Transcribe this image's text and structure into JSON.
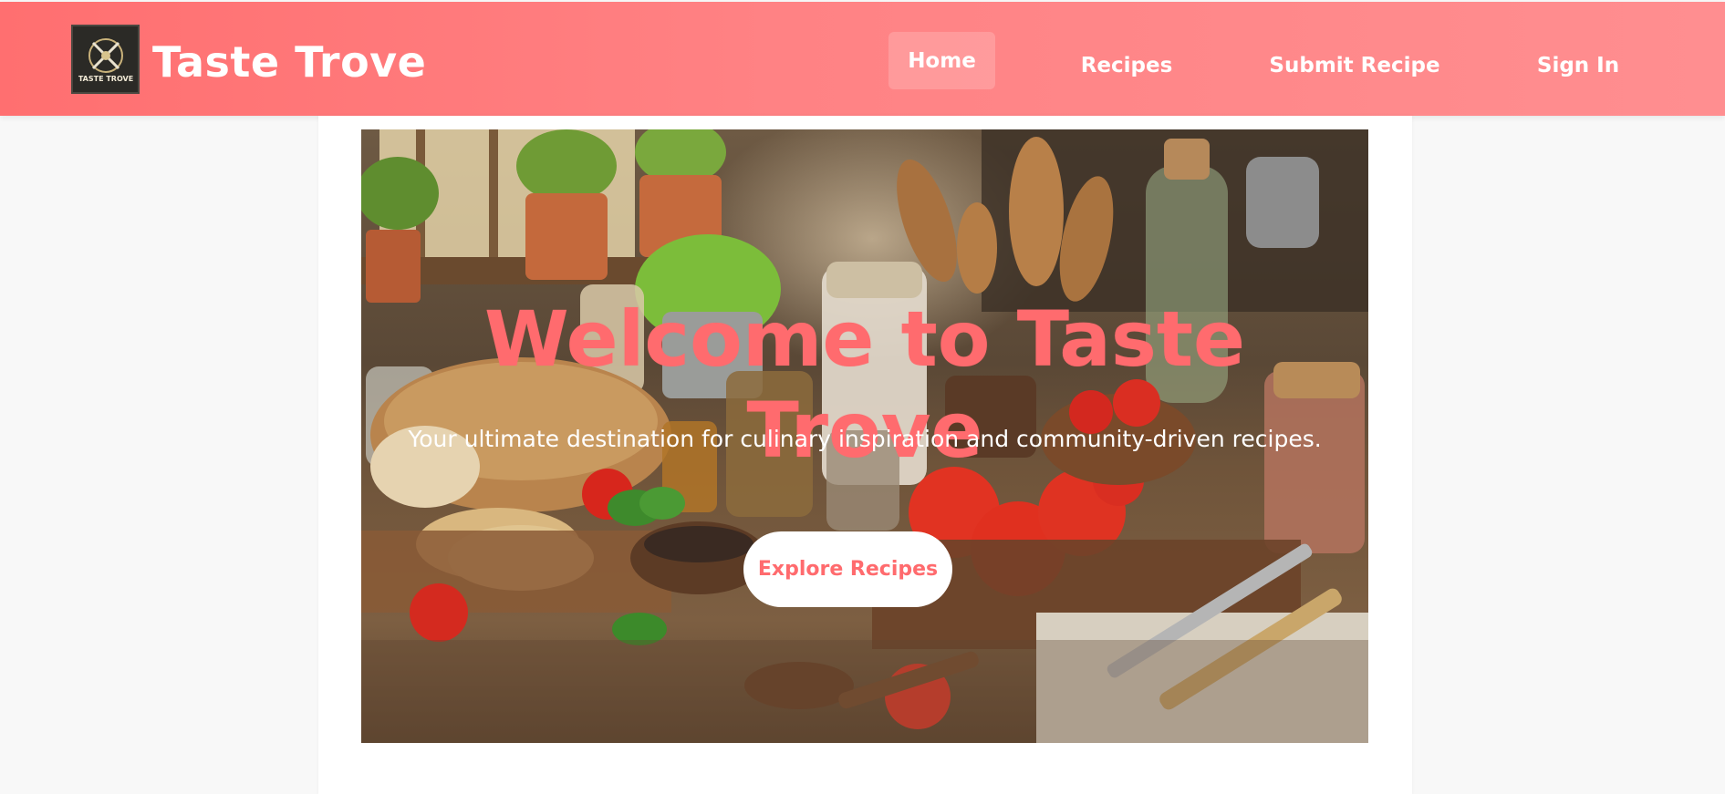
{
  "header": {
    "brand": "Taste Trove",
    "logo_text": "TASTE TROVE",
    "nav": [
      {
        "label": "Home",
        "active": true
      },
      {
        "label": "Recipes"
      },
      {
        "label": "Submit Recipe"
      },
      {
        "label": "Sign In"
      }
    ]
  },
  "hero": {
    "title": "Welcome to Taste Trove",
    "subtitle": "Your ultimate destination for culinary inspiration and community-driven recipes.",
    "button": "Explore Recipes",
    "image": "rustic-kitchen-table-image"
  },
  "colors": {
    "brand": "#ff7b7d",
    "accent_text": "#ff6b6e"
  }
}
